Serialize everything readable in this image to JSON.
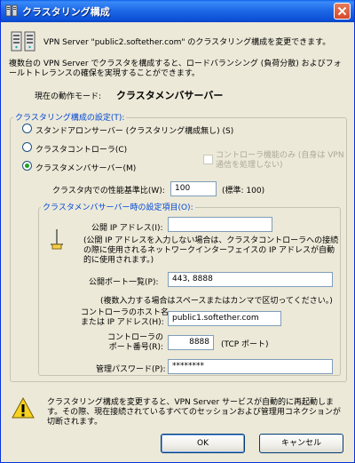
{
  "window": {
    "title": "クラスタリング構成"
  },
  "header": {
    "description": "VPN Server \"public2.softether.com\" のクラスタリング構成を変更できます。",
    "intro": "複数台の VPN Server でクラスタを構成すると、ロードバランシング (負荷分散) およびフォールトトレランスの確保を実現することができます。"
  },
  "mode": {
    "label": "現在の動作モード:",
    "value": "クラスタメンバサーバー"
  },
  "settings": {
    "legend": "クラスタリング構成の設定(T):",
    "standalone": "スタンドアロンサーバー (クラスタリング構成無し) (S)",
    "controller": "クラスタコントローラ(C)",
    "member": "クラスタメンバサーバー(M)",
    "controller_only": "コントローラ機能のみ (自身は VPN 通信を処理しない)",
    "perf_label": "クラスタ内での性能基準比(W):",
    "perf_value": "100",
    "perf_note": "(標準: 100)"
  },
  "member_settings": {
    "legend": "クラスタメンバサーバー時の設定項目(O):",
    "public_ip_label": "公開 IP アドレス(I):",
    "public_ip_value": "",
    "public_ip_note": "(公開 IP アドレスを入力しない場合は、クラスタコントローラへの接続の際に使用されるネットワークインターフェイスの IP アドレスが自動的に使用されます。)",
    "ports_label": "公開ポート一覧(P):",
    "ports_value": "443, 8888",
    "ports_note": "(複数入力する場合はスペースまたはカンマで区切ってください。)",
    "host_label_1": "コントローラのホスト名",
    "host_label_2": "または IP アドレス(H):",
    "host_value": "public1.softether.com",
    "port_label_1": "コントローラの",
    "port_label_2": "ポート番号(R):",
    "port_value": "8888",
    "port_note": "(TCP ポート)",
    "password_label": "管理パスワード(P):",
    "password_value": "********"
  },
  "footer": {
    "warning": "クラスタリング構成を変更すると、VPN Server サービスが自動的に再起動します。その際、現在接続されているすべてのセッションおよび管理用コネクションが切断されます。",
    "ok_label": "OK",
    "cancel_label": "キャンセル"
  }
}
